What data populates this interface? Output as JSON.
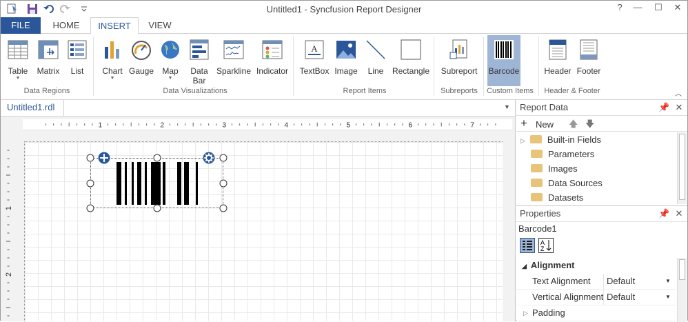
{
  "window": {
    "title": "Untitled1 - Syncfusion Report Designer",
    "help": "?",
    "minimize": "—",
    "maximize": "☐",
    "close": "✕"
  },
  "tabs": {
    "file": "FILE",
    "home": "HOME",
    "insert": "INSERT",
    "view": "VIEW"
  },
  "ribbon": {
    "buttons": {
      "table": "Table",
      "matrix": "Matrix",
      "list": "List",
      "chart": "Chart",
      "gauge": "Gauge",
      "map": "Map",
      "databar1": "Data",
      "databar2": "Bar",
      "sparkline": "Sparkline",
      "indicator": "Indicator",
      "textbox": "TextBox",
      "image": "Image",
      "line": "Line",
      "rectangle": "Rectangle",
      "subreport": "Subreport",
      "barcode": "Barcode",
      "header": "Header",
      "footer": "Footer"
    },
    "groups": {
      "data_regions": "Data Regions",
      "data_visualizations": "Data Visualizations",
      "report_items": "Report Items",
      "subreports": "Subreports",
      "custom_items": "Custom Items",
      "header_footer": "Header & Footer"
    }
  },
  "document": {
    "tab": "Untitled1.rdl"
  },
  "ruler": {
    "h_labels": [
      "1",
      "2",
      "3",
      "4",
      "5",
      "6",
      "7"
    ],
    "v_labels": [
      "1",
      "2"
    ]
  },
  "report_data": {
    "title": "Report Data",
    "new_label": "New",
    "items": [
      "Built-in Fields",
      "Parameters",
      "Images",
      "Data Sources",
      "Datasets"
    ]
  },
  "properties": {
    "title": "Properties",
    "selected": "Barcode1",
    "section": "Alignment",
    "rows": [
      {
        "name": "Text Alignment",
        "value": "Default"
      },
      {
        "name": "Vertical Alignment",
        "value": "Default"
      }
    ],
    "padding": "Padding"
  },
  "colors": {
    "accent": "#2b579a",
    "selected_button": "#9fb5d6"
  }
}
